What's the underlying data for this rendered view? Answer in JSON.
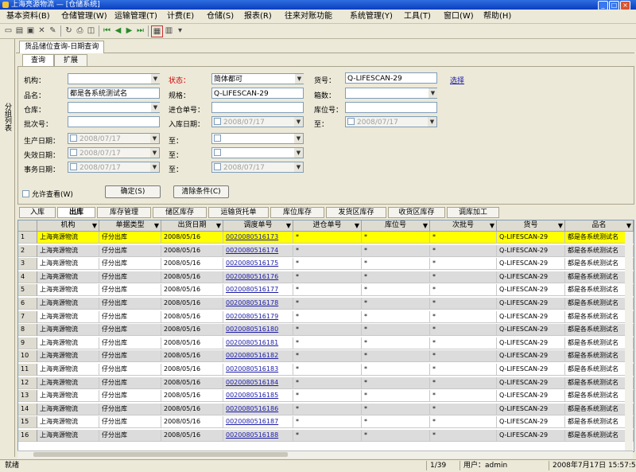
{
  "window": {
    "title": "上海亮源物流 — [仓储系统]"
  },
  "menu": [
    "基本资料(B)",
    "仓储管理(W)",
    "运输管理(T)",
    "计费(E)",
    "仓储(S)",
    "报表(R)",
    "往来对账功能",
    "系统管理(Y)",
    "工具(T)",
    "窗口(W)",
    "帮助(H)"
  ],
  "leftstrip": {
    "label": "分组列表"
  },
  "doc_tab": "货品储位查询-日期查询",
  "inner_tabs": [
    "查询",
    "扩展"
  ],
  "form": {
    "labels": {
      "jigou": "机构：",
      "pinming": "品名：",
      "cangku": "仓库：",
      "jihao": "批次号：",
      "shengchan": "生产日期：",
      "shixiao": "失效日期：",
      "shiwu": "事务日期：",
      "zhuangtai": "状态：",
      "xinghao": "规格：",
      "jinruku": "进仓单号：",
      "ruku": "入库日期：",
      "a": "至：",
      "b": "至：",
      "c": "至：",
      "huohao": "货号：",
      "xiangshu": "箱数：",
      "cunwei": "库位号：",
      "zhi": "至："
    },
    "values": {
      "jigou": "",
      "pinming": "都是各系统测试名",
      "cangku": "",
      "jihao": "",
      "zhuangtai": "简体都可",
      "xinghao": "Q-LIFESCAN-29",
      "jinruku": "",
      "ruku_date": "2008/07/17",
      "huohao": "Q-LIFESCAN-29",
      "xiangshu": "",
      "cunwei": "",
      "zhi_date": "2008/07/17",
      "shengchan_date": "2008/07/17",
      "shixiao_date": "2008/07/17",
      "shiwu_date": "2008/07/17",
      "a_val": "",
      "b_val": "",
      "c_val": "2008/07/17"
    },
    "link": "选择",
    "checkbox_all": "允许查看(W)",
    "btn_query": "确定(S)",
    "btn_clear": "清除条件(C)"
  },
  "lower_tabs": [
    "入库",
    "出库",
    "库存管理",
    "储区库存",
    "运输货托单",
    "库位库存",
    "发货区库存",
    "收货区库存",
    "调库加工"
  ],
  "grid": {
    "headers": [
      "",
      "机构",
      "单据类型",
      "出货日期",
      "调度单号",
      "进仓单号",
      "库位号",
      "次批号",
      "货号",
      "品名"
    ],
    "rows": [
      [
        "1",
        "上海亮源物流",
        "仔分出库",
        "2008/05/16",
        "0020080516173",
        "*",
        "*",
        "*",
        "Q-LIFESCAN-29",
        "都是各系统测试名"
      ],
      [
        "2",
        "上海亮源物流",
        "仔分出库",
        "2008/05/16",
        "0020080516174",
        "*",
        "*",
        "*",
        "Q-LIFESCAN-29",
        "都是各系统测试名"
      ],
      [
        "3",
        "上海亮源物流",
        "仔分出库",
        "2008/05/16",
        "0020080516175",
        "*",
        "*",
        "*",
        "Q-LIFESCAN-29",
        "都是各系统测试名"
      ],
      [
        "4",
        "上海亮源物流",
        "仔分出库",
        "2008/05/16",
        "0020080516176",
        "*",
        "*",
        "*",
        "Q-LIFESCAN-29",
        "都是各系统测试名"
      ],
      [
        "5",
        "上海亮源物流",
        "仔分出库",
        "2008/05/16",
        "0020080516177",
        "*",
        "*",
        "*",
        "Q-LIFESCAN-29",
        "都是各系统测试名"
      ],
      [
        "6",
        "上海亮源物流",
        "仔分出库",
        "2008/05/16",
        "0020080516178",
        "*",
        "*",
        "*",
        "Q-LIFESCAN-29",
        "都是各系统测试名"
      ],
      [
        "7",
        "上海亮源物流",
        "仔分出库",
        "2008/05/16",
        "0020080516179",
        "*",
        "*",
        "*",
        "Q-LIFESCAN-29",
        "都是各系统测试名"
      ],
      [
        "8",
        "上海亮源物流",
        "仔分出库",
        "2008/05/16",
        "0020080516180",
        "*",
        "*",
        "*",
        "Q-LIFESCAN-29",
        "都是各系统测试名"
      ],
      [
        "9",
        "上海亮源物流",
        "仔分出库",
        "2008/05/16",
        "0020080516181",
        "*",
        "*",
        "*",
        "Q-LIFESCAN-29",
        "都是各系统测试名"
      ],
      [
        "10",
        "上海亮源物流",
        "仔分出库",
        "2008/05/16",
        "0020080516182",
        "*",
        "*",
        "*",
        "Q-LIFESCAN-29",
        "都是各系统测试名"
      ],
      [
        "11",
        "上海亮源物流",
        "仔分出库",
        "2008/05/16",
        "0020080516183",
        "*",
        "*",
        "*",
        "Q-LIFESCAN-29",
        "都是各系统测试名"
      ],
      [
        "12",
        "上海亮源物流",
        "仔分出库",
        "2008/05/16",
        "0020080516184",
        "*",
        "*",
        "*",
        "Q-LIFESCAN-29",
        "都是各系统测试名"
      ],
      [
        "13",
        "上海亮源物流",
        "仔分出库",
        "2008/05/16",
        "0020080516185",
        "*",
        "*",
        "*",
        "Q-LIFESCAN-29",
        "都是各系统测试名"
      ],
      [
        "14",
        "上海亮源物流",
        "仔分出库",
        "2008/05/16",
        "0020080516186",
        "*",
        "*",
        "*",
        "Q-LIFESCAN-29",
        "都是各系统测试名"
      ],
      [
        "15",
        "上海亮源物流",
        "仔分出库",
        "2008/05/16",
        "0020080516187",
        "*",
        "*",
        "*",
        "Q-LIFESCAN-29",
        "都是各系统测试名"
      ],
      [
        "16",
        "上海亮源物流",
        "仔分出库",
        "2008/05/16",
        "0020080516188",
        "*",
        "*",
        "*",
        "Q-LIFESCAN-29",
        "都是各系统测试名"
      ]
    ],
    "selected_row": 0
  },
  "status": {
    "left": "就绪",
    "page": "1/39",
    "user": "用户：admin",
    "datetime": "2008年7月17日 15:57:52"
  },
  "colors": {
    "selected": "#ffff00",
    "alt_row": "#dcdcdc",
    "link": "#1a1aa6"
  }
}
